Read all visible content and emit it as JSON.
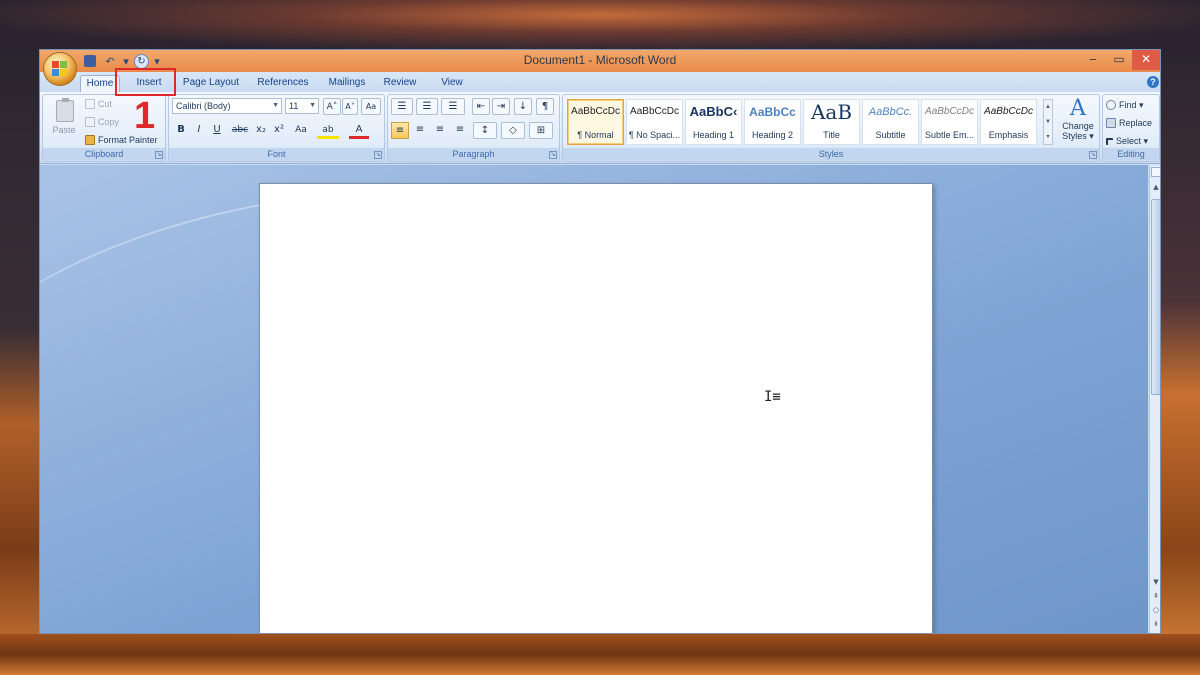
{
  "window": {
    "title": "Document1 - Microsoft Word",
    "minimize": "‒",
    "maximize": "▭",
    "close": "✕"
  },
  "quick_access": {
    "undo": "↶",
    "undo_dropdown": "▾",
    "redo": "↻",
    "customize": "▾"
  },
  "tabs": [
    "Home",
    "Insert",
    "Page Layout",
    "References",
    "Mailings",
    "Review",
    "View"
  ],
  "active_tab": "Home",
  "help": "?",
  "annotation": {
    "step_number": "1",
    "highlight_color": "#e0282a"
  },
  "clipboard": {
    "paste": "Paste",
    "cut": "Cut",
    "copy": "Copy",
    "format_painter": "Format Painter",
    "group_label": "Clipboard"
  },
  "font": {
    "font_name": "Calibri (Body)",
    "font_size": "11",
    "grow": "A˄",
    "shrink": "A˅",
    "clear": "Aa",
    "bold": "B",
    "italic": "I",
    "underline": "U",
    "strikethrough": "abc",
    "subscript": "x₂",
    "superscript": "x²",
    "change_case": "Aa",
    "highlight": "ab",
    "font_color": "A",
    "group_label": "Font"
  },
  "paragraph": {
    "bullets": "☰",
    "numbering": "☰",
    "multilevel": "☰",
    "decrease_indent": "⇤",
    "increase_indent": "⇥",
    "sort": "↓",
    "show_marks": "¶",
    "align_left": "≡",
    "center": "≡",
    "align_right": "≡",
    "justify": "≡",
    "line_spacing": "↕",
    "shading": "◇",
    "borders": "⊞",
    "group_label": "Paragraph"
  },
  "styles": {
    "items": [
      {
        "sample": "AaBbCcDc",
        "name": "¶ Normal"
      },
      {
        "sample": "AaBbCcDc",
        "name": "¶ No Spaci..."
      },
      {
        "sample": "AaBbC‹",
        "name": "Heading 1"
      },
      {
        "sample": "AaBbCc",
        "name": "Heading 2"
      },
      {
        "sample": "AaB",
        "name": "Title"
      },
      {
        "sample": "AaBbCc.",
        "name": "Subtitle"
      },
      {
        "sample": "AaBbCcDc",
        "name": "Subtle Em..."
      },
      {
        "sample": "AaBbCcDc",
        "name": "Emphasis"
      }
    ],
    "selected_index": 0,
    "change_styles_line1": "Change",
    "change_styles_line2": "Styles ▾",
    "group_label": "Styles"
  },
  "editing": {
    "find": "Find ▾",
    "replace": "Replace",
    "select": "Select ▾",
    "group_label": "Editing"
  },
  "document": {
    "cursor": "I≡"
  },
  "scrollbar": {
    "up": "▲",
    "down": "▼",
    "prev_page": "⇞",
    "browse": "○",
    "next_page": "⇟"
  }
}
